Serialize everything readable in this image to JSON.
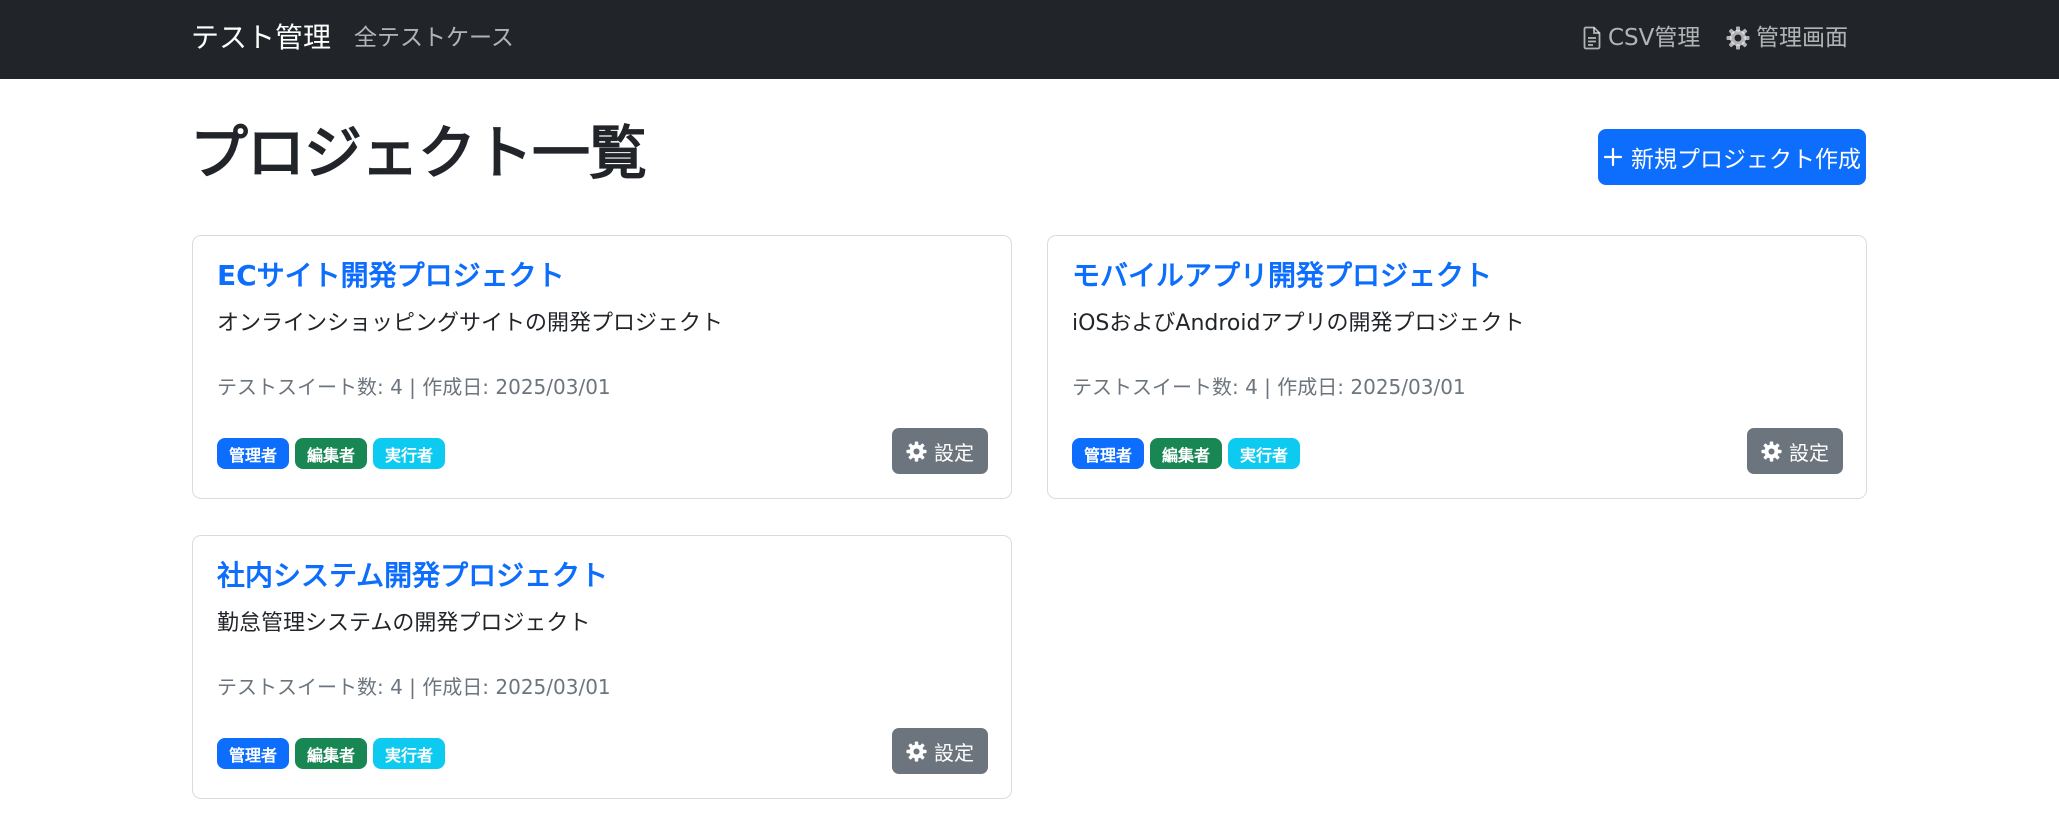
{
  "navbar": {
    "brand": "テスト管理",
    "all_test_cases": "全テストケース",
    "csv": "CSV管理",
    "admin": "管理画面"
  },
  "header": {
    "title": "プロジェクト一覧",
    "new_project": "新規プロジェクト作成"
  },
  "projects": [
    {
      "title": "ECサイト開発プロジェクト",
      "description": "オンラインショッピングサイトの開発プロジェクト",
      "meta": "テストスイート数: 4 | 作成日: 2025/03/01",
      "roles": [
        "管理者",
        "編集者",
        "実行者"
      ],
      "settings": "設定"
    },
    {
      "title": "モバイルアプリ開発プロジェクト",
      "description": "iOSおよびAndroidアプリの開発プロジェクト",
      "meta": "テストスイート数: 4 | 作成日: 2025/03/01",
      "roles": [
        "管理者",
        "編集者",
        "実行者"
      ],
      "settings": "設定"
    },
    {
      "title": "社内システム開発プロジェクト",
      "description": "勤怠管理システムの開発プロジェクト",
      "meta": "テストスイート数: 4 | 作成日: 2025/03/01",
      "roles": [
        "管理者",
        "編集者",
        "実行者"
      ],
      "settings": "設定"
    }
  ],
  "colors": {
    "navbar": "#212529",
    "primary": "#0d6efd",
    "success": "#198754",
    "info": "#0dcaf0",
    "secondary": "#6c757d"
  },
  "icons": {
    "csv": "file-text-icon",
    "admin": "gear-icon",
    "new_project": "plus-icon",
    "settings": "gear-icon"
  }
}
